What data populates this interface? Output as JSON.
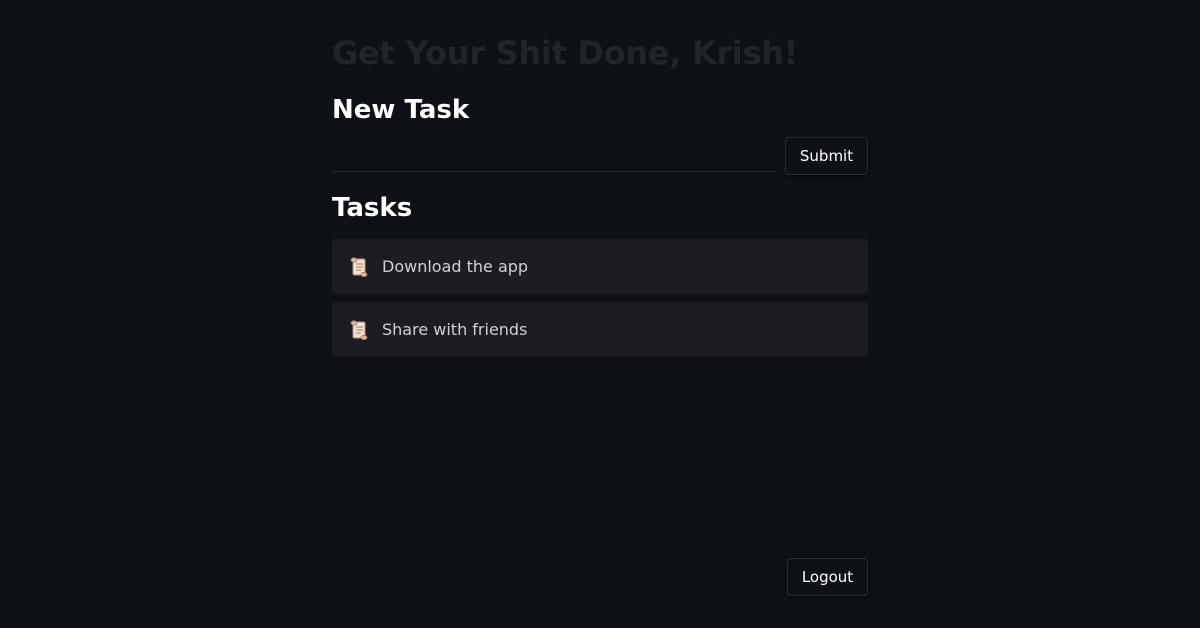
{
  "header": {
    "title": "Get Your Shit Done, Krish!"
  },
  "new_task": {
    "heading": "New Task",
    "input_value": "",
    "input_placeholder": "",
    "submit_label": "Submit"
  },
  "tasks": {
    "heading": "Tasks",
    "items": [
      {
        "icon": "scroll-icon",
        "label": "Download the app"
      },
      {
        "icon": "scroll-icon",
        "label": "Share with friends"
      }
    ]
  },
  "footer": {
    "logout_label": "Logout"
  },
  "colors": {
    "background": "#0e1116",
    "task_card": "#1c1d22",
    "title_faded": "#20242b",
    "heading": "#ffffff",
    "task_text": "#cfd1d6"
  }
}
